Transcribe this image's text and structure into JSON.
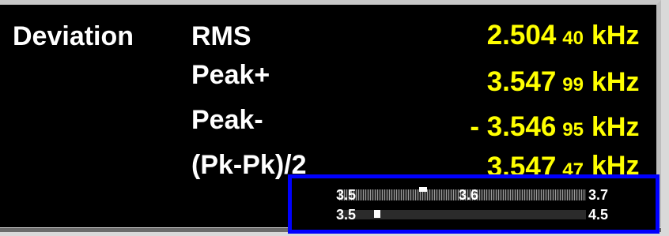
{
  "measurement": {
    "section_label": "Deviation",
    "rows": [
      {
        "label": "RMS",
        "value_major": "2.504",
        "value_minor": "40",
        "unit": "kHz"
      },
      {
        "label": "Peak+",
        "value_major": "3.547",
        "value_minor": "99",
        "unit": "kHz"
      },
      {
        "label": "Peak-",
        "value_major": "- 3.546",
        "value_minor": "95",
        "unit": "kHz"
      },
      {
        "label": "(Pk-Pk)/2",
        "value_major": "3.547",
        "value_minor": "47",
        "unit": "kHz"
      }
    ]
  },
  "scale": {
    "upper_left": "3.5",
    "upper_mid": "3.6",
    "upper_right": "3.7",
    "lower_left": "3.5",
    "lower_right": "4.5"
  },
  "colors": {
    "value": "#ffff00",
    "label": "#ffffff",
    "background": "#000000",
    "highlight_frame": "#0000ff"
  }
}
